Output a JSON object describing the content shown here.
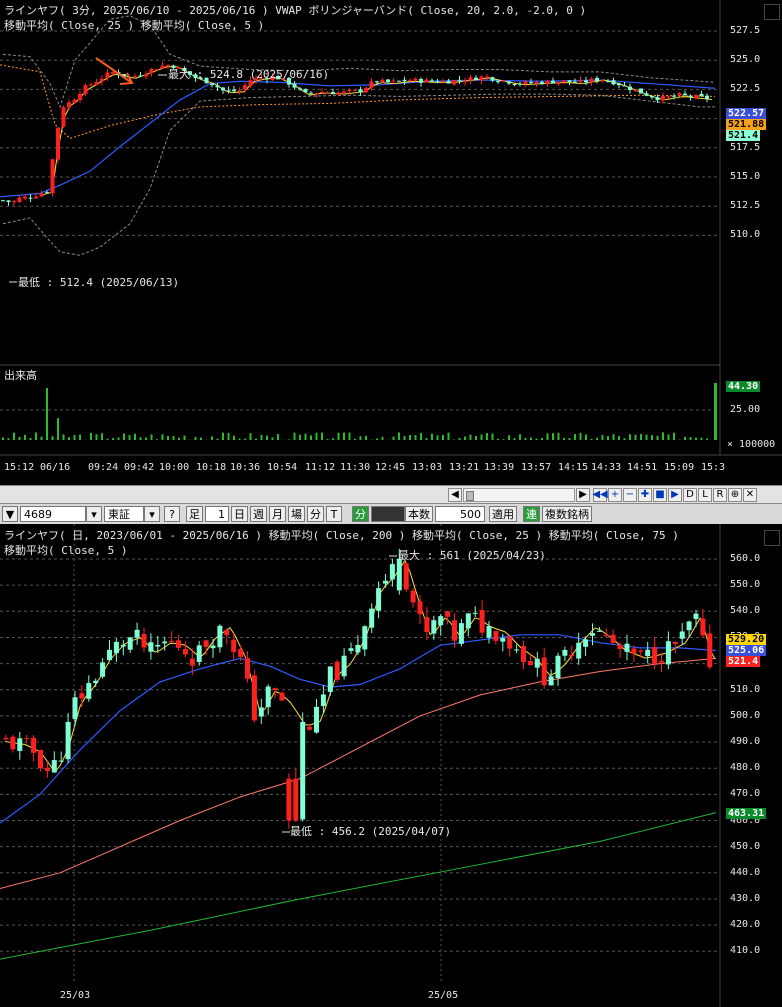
{
  "intraday": {
    "title_line1": "ラインヤフ( 3分, 2025/06/10 - 2025/06/16 )   VWAP    ボリンジャーバンド( Close, 20, 2.0, -2.0, 0 )",
    "title_line2": "移動平均( Close, 25 )   移動平均( Close, 5 )",
    "max_label": "最大 : 524.8 (2025/06/16)",
    "min_label": "最低 : 512.4 (2025/06/13)",
    "y_ticks": [
      "527.5",
      "525.0",
      "522.5",
      "520.0",
      "517.5",
      "515.0",
      "512.5",
      "510.0"
    ],
    "badges": [
      {
        "text": "522.57",
        "color": "#3a4fd8",
        "fg": "#ffffff"
      },
      {
        "text": "521.88",
        "color": "#f5a11a",
        "fg": "#000000"
      },
      {
        "text": "521.4",
        "color": "#8affd6",
        "fg": "#000000"
      }
    ],
    "volume_label": "出来高",
    "volume_badge": "44.30",
    "volume_tick": "25.00",
    "volume_scale": "× 100000",
    "time_labels": [
      "15:12",
      "06/16",
      "09:24",
      "09:42",
      "10:00",
      "10:18",
      "10:36",
      "10:54",
      "11:12",
      "11:30",
      "12:45",
      "13:03",
      "13:21",
      "13:39",
      "13:57",
      "14:15",
      "14:33",
      "14:51",
      "15:09",
      "15:3"
    ]
  },
  "scrollbar": {
    "buttons": [
      "◀◀",
      "+",
      "−",
      "✚",
      "■",
      "▶",
      "D",
      "L",
      "R",
      "⊕",
      "✕"
    ]
  },
  "toolbar": {
    "menu_arrow": "▼",
    "code": "4689",
    "market": "東証",
    "help": "?",
    "foot": "足",
    "foot_value": "1",
    "day": "日",
    "week": "週",
    "month": "月",
    "session": "場",
    "minute": "分",
    "tick": "T",
    "minute2": "分",
    "count_label": "本数",
    "count_value": "500",
    "apply": "適用",
    "link": "連",
    "multi": "複数銘柄"
  },
  "daily": {
    "title_line1": "ラインヤフ( 日, 2023/06/01 - 2025/06/16 )   移動平均( Close, 200 )   移動平均( Close, 25 )   移動平均( Close, 75 )",
    "title_line2": "移動平均( Close, 5 )",
    "max_label": "最大 : 561 (2025/04/23)",
    "min_label": "最低 : 456.2 (2025/04/07)",
    "y_ticks": [
      "560.0",
      "550.0",
      "540.0",
      "530.0",
      "520.0",
      "510.0",
      "500.0",
      "490.0",
      "480.0",
      "470.0",
      "460.0",
      "450.0",
      "440.0",
      "430.0",
      "420.0",
      "410.0"
    ],
    "badges": [
      {
        "text": "529.20",
        "color": "#ffd400",
        "fg": "#000000"
      },
      {
        "text": "525.06",
        "color": "#3a4fd8",
        "fg": "#ffffff"
      },
      {
        "text": "521.4",
        "color": "#ff2020",
        "fg": "#ffffff"
      },
      {
        "text": "463.31",
        "color": "#0a8a2a",
        "fg": "#ffffff"
      }
    ],
    "x_labels": [
      "25/03",
      "25/05"
    ]
  }
}
